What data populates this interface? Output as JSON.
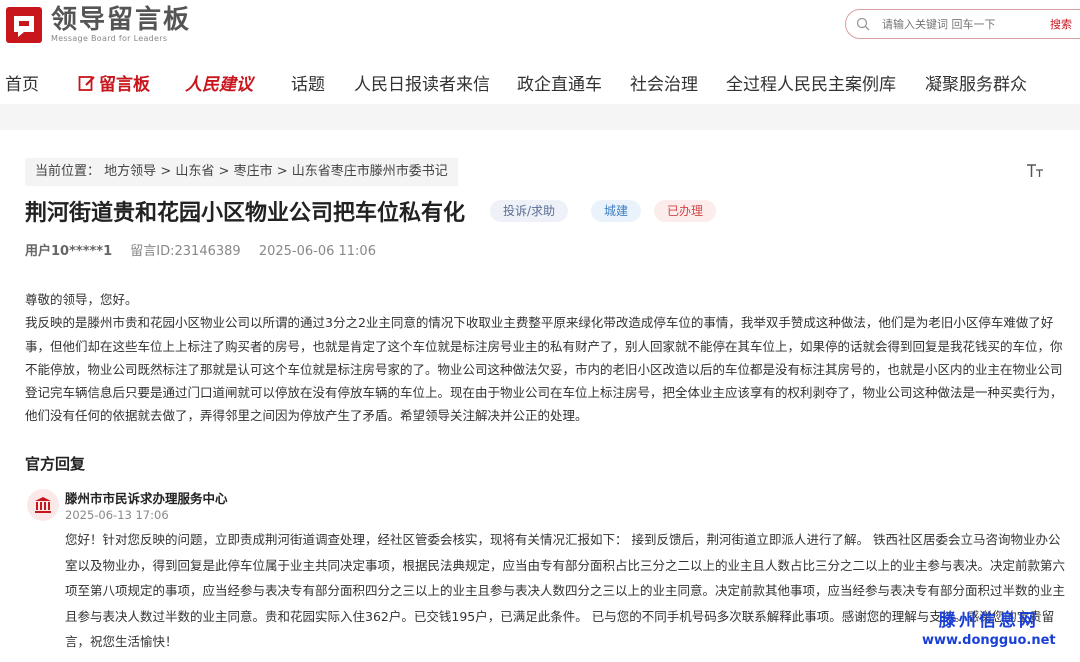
{
  "header": {
    "logo_title": "领导留言板",
    "logo_subtitle": "Message Board for Leaders",
    "search_placeholder": "请输入关键词 回车一下",
    "search_button": "搜索"
  },
  "nav": {
    "items": [
      "首页",
      "留言板",
      "人民建议",
      "话题",
      "人民日报读者来信",
      "政企直通车",
      "社会治理",
      "全过程人民民主案例库",
      "凝聚服务群众"
    ]
  },
  "breadcrumb": {
    "prefix": "当前位置：",
    "items": [
      "地方领导",
      "山东省",
      "枣庄市",
      "山东省枣庄市滕州市委书记"
    ],
    "separator": ">"
  },
  "message": {
    "title": "荆河街道贵和花园小区物业公司把车位私有化",
    "tags": {
      "type": "投诉/求助",
      "field": "城建",
      "status": "已办理"
    },
    "user": "用户10*****1",
    "message_id": "留言ID:23146389",
    "date": "2025-06-06 11:06",
    "greeting": "尊敬的领导，您好。",
    "content": "我反映的是滕州市贵和花园小区物业公司以所谓的通过3分之2业主同意的情况下收取业主费整平原来绿化带改造成停车位的事情，我举双手赞成这种做法，他们是为老旧小区停车难做了好事，但他们却在这些车位上上标注了购买者的房号，也就是肯定了这个车位就是标注房号业主的私有财产了，别人回家就不能停在其车位上，如果停的话就会得到回复是我花钱买的车位，你不能停放，物业公司既然标注了那就是认可这个车位就是标注房号家的了。物业公司这种做法欠妥，市内的老旧小区改造以后的车位都是没有标注其房号的，也就是小区内的业主在物业公司登记完车辆信息后只要是通过门口道闸就可以停放在没有停放车辆的车位上。现在由于物业公司在车位上标注房号，把全体业主应该享有的权利剥夺了，物业公司这种做法是一种买卖行为，他们没有任何的依据就去做了，弄得邻里之间因为停放产生了矛盾。希望领导关注解决并公正的处理。"
  },
  "reply": {
    "heading": "官方回复",
    "department": "滕州市市民诉求办理服务中心",
    "date": "2025-06-13 17:06",
    "content": "您好！针对您反映的问题，立即责成荆河街道调查处理，经社区管委会核实，现将有关情况汇报如下： 接到反馈后，荆河街道立即派人进行了解。 铁西社区居委会立马咨询物业办公室以及物业办，得到回复是此停车位属于业主共同决定事项，根据民法典规定，应当由专有部分面积占比三分之二以上的业主且人数占比三分之二以上的业主参与表决。决定前款第六项至第八项规定的事项，应当经参与表决专有部分面积四分之三以上的业主且参与表决人数四分之三以上的业主同意。决定前款其他事项，应当经参与表决专有部分面积过半数的业主且参与表决人数过半数的业主同意。贵和花园实际入住362户。已交钱195户，已满足此条件。 已与您的不同手机号码多次联系解释此事项。感谢您的理解与支持。感谢您的宝贵留言，祝您生活愉快！"
  },
  "watermark": {
    "line1": "滕州信息网",
    "line2": "www.dongguo.net"
  },
  "colors": {
    "brand_red": "#c8161d",
    "watermark_blue": "#1a3fd6"
  }
}
